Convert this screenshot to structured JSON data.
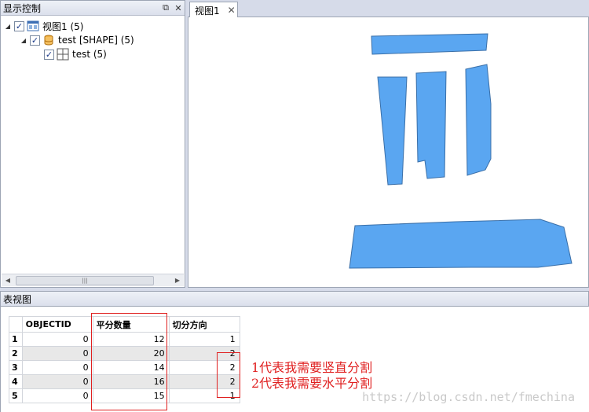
{
  "left_panel": {
    "title": "显示控制",
    "pin_icon": "pin-icon",
    "close_icon": "close-icon",
    "tree": [
      {
        "label": "视图1 (5)",
        "icon": "view-icon",
        "checked": true
      },
      {
        "label": "test [SHAPE] (5)",
        "icon": "database-icon",
        "checked": true
      },
      {
        "label": "test (5)",
        "icon": "grid-layer-icon",
        "checked": true
      }
    ],
    "scroll_grip": "|||"
  },
  "view": {
    "tab_label": "视图1",
    "tab_close": "✕",
    "polygon_color": "#5aa6f1"
  },
  "bottom": {
    "title": "表视图",
    "columns": [
      "OBJECTID",
      "平分数量",
      "切分方向"
    ],
    "rows": [
      {
        "num": "1",
        "objectid": "0",
        "count": "12",
        "direction": "1"
      },
      {
        "num": "2",
        "objectid": "0",
        "count": "20",
        "direction": "2"
      },
      {
        "num": "3",
        "objectid": "0",
        "count": "14",
        "direction": "2"
      },
      {
        "num": "4",
        "objectid": "0",
        "count": "16",
        "direction": "2"
      },
      {
        "num": "5",
        "objectid": "0",
        "count": "15",
        "direction": "1"
      }
    ]
  },
  "annotation": {
    "line1": "1代表我需要竖直分割",
    "line2": "2代表我需要水平分割",
    "color": "#e02020"
  },
  "watermark": "https://blog.csdn.net/fmechina"
}
